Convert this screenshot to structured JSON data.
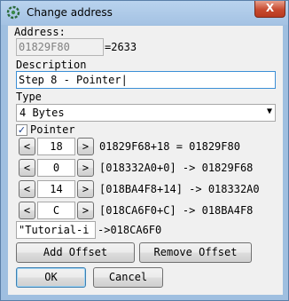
{
  "window": {
    "title": "Change address",
    "close_label": "X"
  },
  "address": {
    "label": "Address:",
    "value": "01829F80",
    "result": "=2633"
  },
  "description": {
    "label": "Description",
    "value": "Step 8 - Pointer|"
  },
  "type": {
    "label": "Type",
    "selected": "4 Bytes",
    "arrow": "▼"
  },
  "pointer": {
    "label": "Pointer",
    "checked": true,
    "check_mark": "✓"
  },
  "offsets": [
    {
      "dec": "<",
      "value": "18",
      "inc": ">",
      "resolution": "01829F68+18 = 01829F80"
    },
    {
      "dec": "<",
      "value": "0",
      "inc": ">",
      "resolution": "[018332A0+0] -> 01829F68"
    },
    {
      "dec": "<",
      "value": "14",
      "inc": ">",
      "resolution": "[018BA4F8+14] -> 018332A0"
    },
    {
      "dec": "<",
      "value": "C",
      "inc": ">",
      "resolution": "[018CA6F0+C] -> 018BA4F8"
    }
  ],
  "base": {
    "value": "\"Tutorial-i",
    "resolution": "->018CA6F0"
  },
  "buttons": {
    "add_offset": "Add Offset",
    "remove_offset": "Remove Offset",
    "ok": "OK",
    "cancel": "Cancel"
  }
}
